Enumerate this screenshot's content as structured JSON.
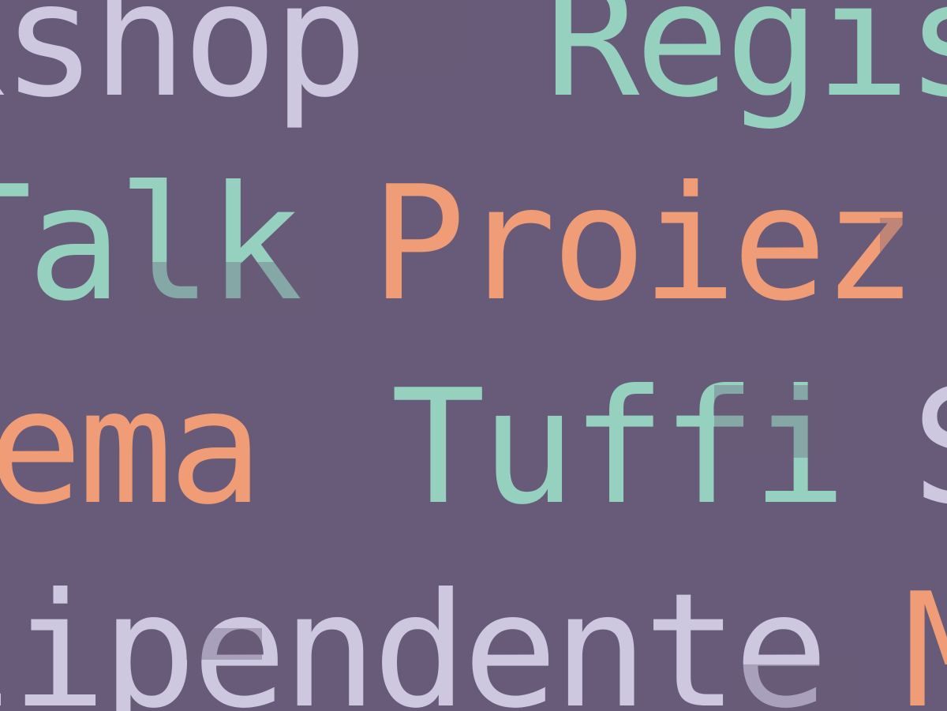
{
  "background": "#675b79",
  "colors": {
    "lavender": "#cdc7e0",
    "mint": "#96d1bf",
    "peach": "#f09c76"
  },
  "rows": [
    {
      "words": [
        "kshop",
        "Regis"
      ]
    },
    {
      "words": [
        "Talk",
        "Proiez"
      ]
    },
    {
      "words": [
        "hema",
        "Tuffi",
        "S"
      ]
    },
    {
      "words": [
        "lipendente",
        "M"
      ]
    }
  ]
}
